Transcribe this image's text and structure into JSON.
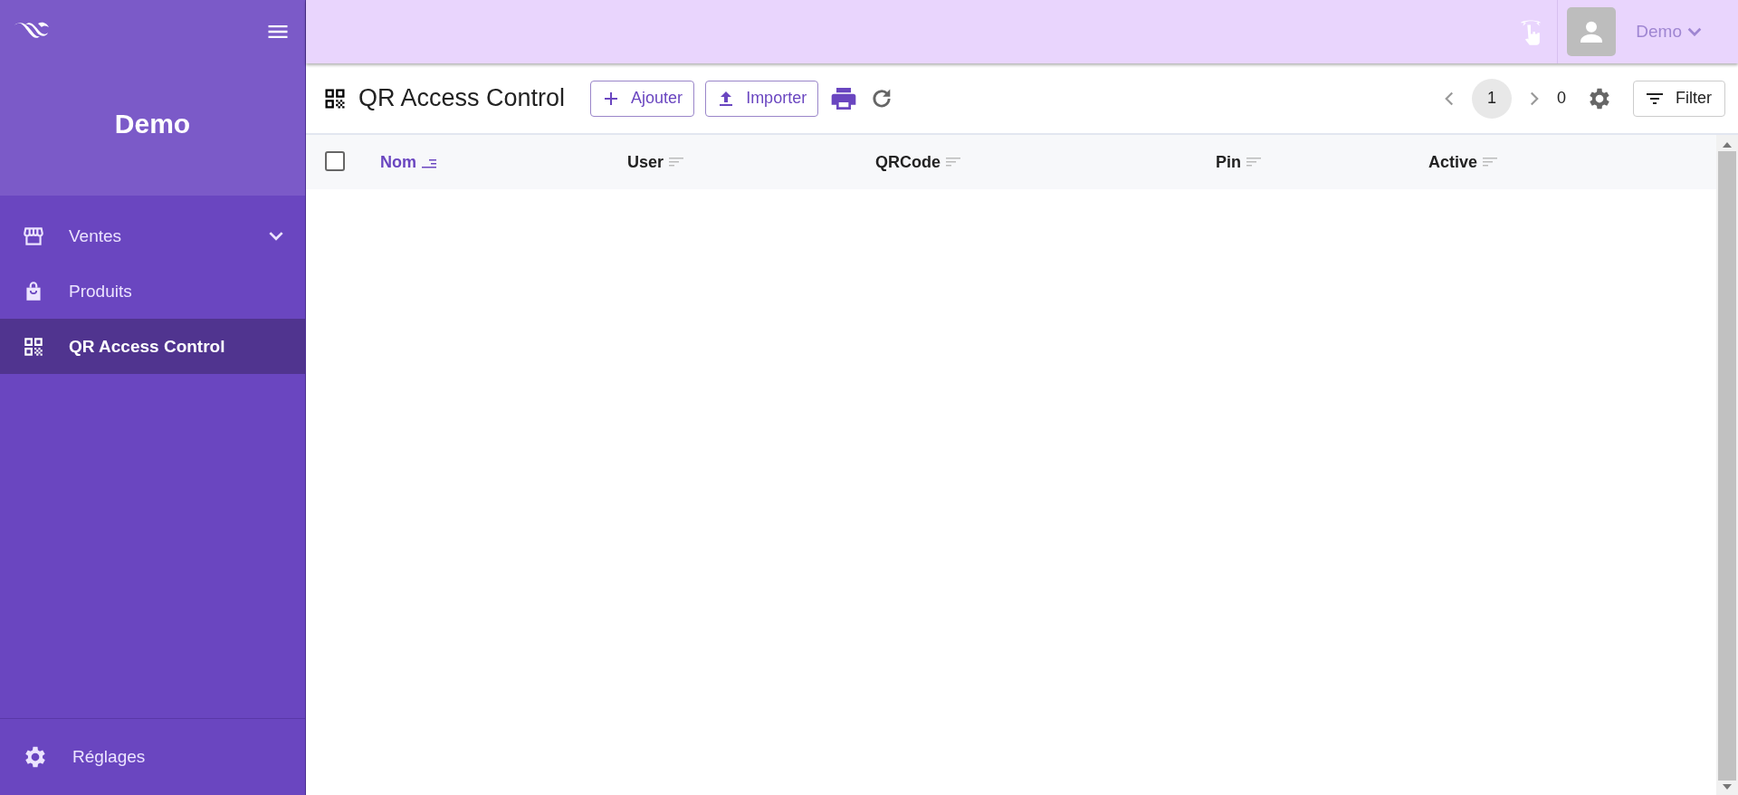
{
  "sidebar": {
    "brand": "Demo",
    "menu": [
      {
        "kind": "store",
        "label": "Ventes",
        "expandable": true,
        "selected": false
      },
      {
        "kind": "bag",
        "label": "Produits",
        "expandable": false,
        "selected": false
      },
      {
        "kind": "qr",
        "label": "QR Access Control",
        "expandable": false,
        "selected": true
      }
    ],
    "footer": {
      "kind": "gear",
      "label": "Réglages"
    }
  },
  "topbar": {
    "user": "Demo"
  },
  "toolbar": {
    "title": "QR Access Control",
    "buttons": [
      {
        "kind": "add",
        "label": "Ajouter"
      },
      {
        "kind": "upload",
        "label": "Importer"
      }
    ],
    "pagination": {
      "page": "1",
      "total": "0"
    },
    "filter": "Filter"
  },
  "table": {
    "select_all": {
      "checked": false
    },
    "columns": [
      {
        "label": "Nom",
        "sorted": true
      },
      {
        "label": "User",
        "sorted": false
      },
      {
        "label": "QRCode",
        "sorted": false
      },
      {
        "label": "Pin",
        "sorted": false
      },
      {
        "label": "Active",
        "sorted": false
      }
    ]
  }
}
